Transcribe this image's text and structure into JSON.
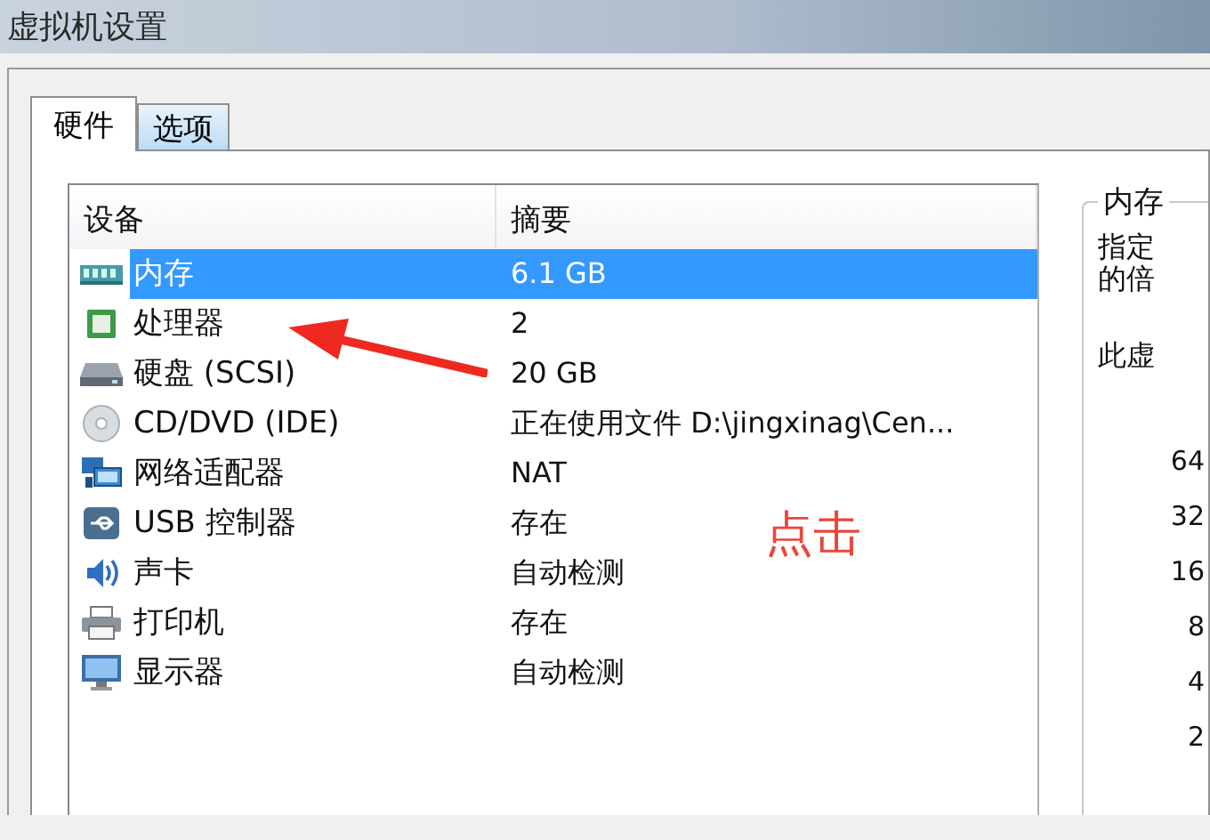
{
  "window": {
    "title": "虚拟机设置"
  },
  "tabs": [
    {
      "label": "硬件",
      "selected": true
    },
    {
      "label": "选项",
      "selected": false
    }
  ],
  "device_list": {
    "columns": [
      "设备",
      "摘要"
    ],
    "rows": [
      {
        "kind": "memory",
        "device": "内存",
        "summary": "6.1 GB",
        "selected": true
      },
      {
        "kind": "cpu",
        "device": "处理器",
        "summary": "2",
        "selected": false
      },
      {
        "kind": "disk",
        "device": "硬盘 (SCSI)",
        "summary": "20 GB",
        "selected": false
      },
      {
        "kind": "cdrom",
        "device": "CD/DVD (IDE)",
        "summary": "正在使用文件 D:\\jingxinag\\Cen...",
        "selected": false
      },
      {
        "kind": "network",
        "device": "网络适配器",
        "summary": "NAT",
        "selected": false
      },
      {
        "kind": "usb",
        "device": "USB 控制器",
        "summary": "存在",
        "selected": false
      },
      {
        "kind": "sound",
        "device": "声卡",
        "summary": "自动检测",
        "selected": false
      },
      {
        "kind": "printer",
        "device": "打印机",
        "summary": "存在",
        "selected": false
      },
      {
        "kind": "display",
        "device": "显示器",
        "summary": "自动检测",
        "selected": false
      }
    ]
  },
  "memory_panel": {
    "title": "内存",
    "description_lines": [
      "指定",
      "的倍"
    ],
    "text": "此虚",
    "scale_labels": [
      "64",
      "32",
      "16",
      "8",
      "4",
      "2"
    ]
  },
  "annotation": {
    "label": "点击"
  }
}
